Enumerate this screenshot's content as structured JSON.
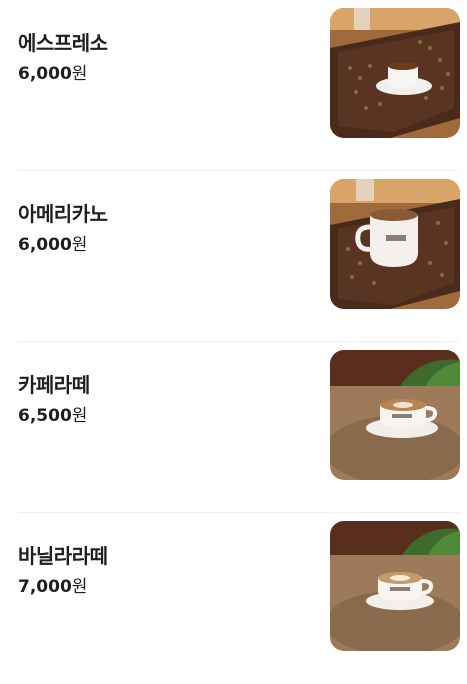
{
  "menu": {
    "items": [
      {
        "name": "에스프레소",
        "price_amount": "6,000",
        "price_unit": "원",
        "image": "espresso-photo"
      },
      {
        "name": "아메리카노",
        "price_amount": "6,000",
        "price_unit": "원",
        "image": "americano-photo"
      },
      {
        "name": "카페라떼",
        "price_amount": "6,500",
        "price_unit": "원",
        "image": "cafe-latte-photo"
      },
      {
        "name": "바닐라라떼",
        "price_amount": "7,000",
        "price_unit": "원",
        "image": "vanilla-latte-photo"
      }
    ]
  },
  "colors": {
    "text": "#1f1f1f",
    "divider": "#eeeeee"
  }
}
